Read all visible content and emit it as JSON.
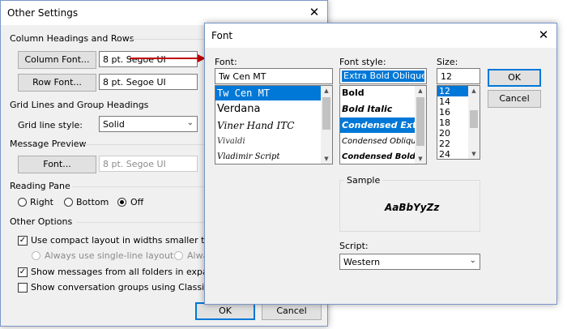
{
  "other_settings": {
    "title": "Other Settings",
    "close_glyph": "✕",
    "column_headings_section": "Column Headings and Rows",
    "column_font_button": "Column Font...",
    "column_font_value": "8 pt. Segoe UI",
    "row_font_button": "Row Font...",
    "row_font_value": "8 pt. Segoe UI",
    "grid_section": "Grid Lines and Group Headings",
    "grid_line_style_label": "Grid line style:",
    "grid_line_style_value": "Solid",
    "preview_section": "Message Preview",
    "preview_font_button": "Font...",
    "preview_font_value": "8 pt. Segoe UI",
    "reading_pane_section": "Reading Pane",
    "reading_pane_options": [
      "Right",
      "Bottom",
      "Off"
    ],
    "reading_pane_selected": "Off",
    "other_options_section": "Other Options",
    "compact_layout_label": "Use compact layout in widths smaller than",
    "compact_layout_checked": true,
    "single_line_label": "Always use single-line layout",
    "always_label": "Alwa",
    "show_all_folders_label": "Show messages from all folders in expand",
    "show_all_folders_checked": true,
    "classic_groups_label": "Show conversation groups using Classic In",
    "classic_groups_checked": false,
    "ok_button": "OK",
    "cancel_button": "Cancel"
  },
  "font_dialog": {
    "title": "Font",
    "close_glyph": "✕",
    "font_label": "Font:",
    "font_value": "Tw Cen MT",
    "font_list": [
      "Tw Cen MT",
      "Verdana",
      "Viner Hand ITC",
      "Vivaldi",
      "Vladimir Script"
    ],
    "font_selected_index": 0,
    "style_label": "Font style:",
    "style_value": "Extra Bold Oblique",
    "style_list": [
      "Bold",
      "Bold Italic",
      "Condensed Extra",
      "Condensed Oblique",
      "Condensed Bold O"
    ],
    "style_selected_index": 2,
    "size_label": "Size:",
    "size_value": "12",
    "size_list": [
      "12",
      "14",
      "16",
      "18",
      "20",
      "22",
      "24"
    ],
    "size_selected_index": 0,
    "ok_button": "OK",
    "cancel_button": "Cancel",
    "sample_label": "Sample",
    "sample_text": "AaBbYyZz",
    "script_label": "Script:",
    "script_value": "Western"
  },
  "colors": {
    "selection": "#0078d7",
    "arrow": "#c00000",
    "dialog_bg": "#f0f0f0"
  }
}
